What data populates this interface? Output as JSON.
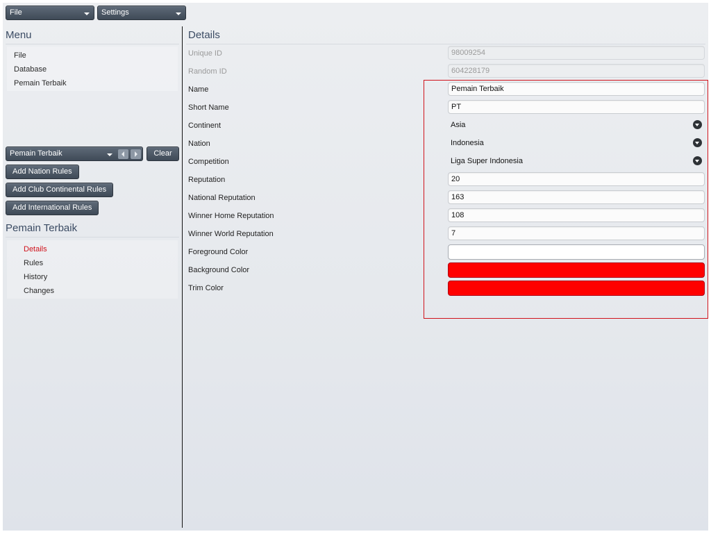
{
  "toolbar": {
    "file_dropdown": "File",
    "settings_dropdown": "Settings"
  },
  "menu": {
    "title": "Menu",
    "items": [
      {
        "label": "File"
      },
      {
        "label": "Database"
      },
      {
        "label": "Pemain Terbaik"
      }
    ]
  },
  "rules_controls": {
    "selector_value": "Pemain Terbaik",
    "clear_label": "Clear",
    "add_nation_rules": "Add Nation Rules",
    "add_club_continental_rules": "Add Club Continental Rules",
    "add_international_rules": "Add International Rules"
  },
  "award": {
    "title": "Pemain Terbaik",
    "nav": [
      {
        "label": "Details",
        "active": true
      },
      {
        "label": "Rules",
        "active": false
      },
      {
        "label": "History",
        "active": false
      },
      {
        "label": "Changes",
        "active": false
      }
    ]
  },
  "details": {
    "title": "Details",
    "fields": {
      "unique_id": {
        "label": "Unique ID",
        "value": "98009254"
      },
      "random_id": {
        "label": "Random ID",
        "value": "604228179"
      },
      "name": {
        "label": "Name",
        "value": "Pemain Terbaik"
      },
      "short_name": {
        "label": "Short Name",
        "value": "PT"
      },
      "continent": {
        "label": "Continent",
        "value": "Asia"
      },
      "nation": {
        "label": "Nation",
        "value": "Indonesia"
      },
      "competition": {
        "label": "Competition",
        "value": "Liga Super Indonesia"
      },
      "reputation": {
        "label": "Reputation",
        "value": "20"
      },
      "national_reputation": {
        "label": "National Reputation",
        "value": "163"
      },
      "winner_home_reputation": {
        "label": "Winner Home Reputation",
        "value": "108"
      },
      "winner_world_reputation": {
        "label": "Winner World Reputation",
        "value": "7"
      },
      "foreground_color": {
        "label": "Foreground Color",
        "value": "#ffffff"
      },
      "background_color": {
        "label": "Background Color",
        "value": "#ff0000"
      },
      "trim_color": {
        "label": "Trim Color",
        "value": "#ff0000"
      }
    }
  },
  "colors": {
    "accent_active": "#d0121b",
    "highlight_border": "#d0121b"
  }
}
